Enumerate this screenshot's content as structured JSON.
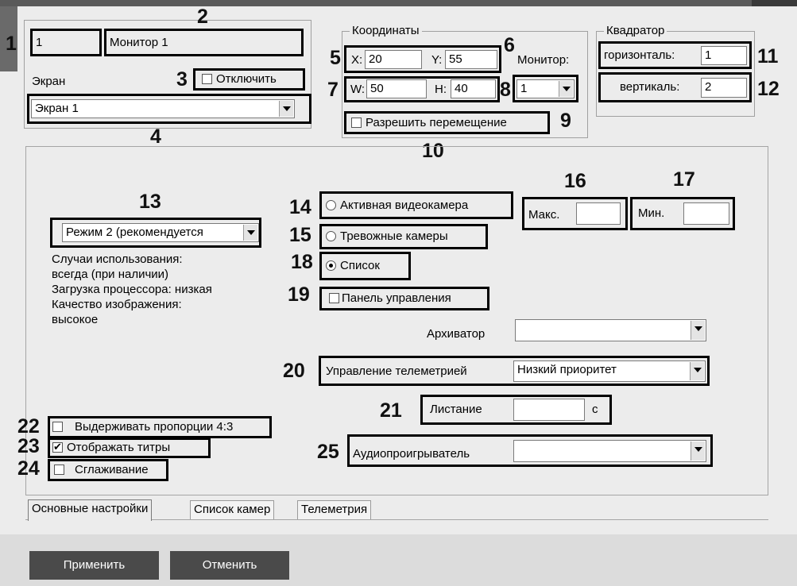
{
  "numbers": [
    "1",
    "2",
    "3",
    "4",
    "5",
    "6",
    "7",
    "8",
    "9",
    "10",
    "11",
    "12",
    "13",
    "14",
    "15",
    "16",
    "17",
    "18",
    "19",
    "20",
    "21",
    "22",
    "23",
    "24",
    "25"
  ],
  "monitor": {
    "id": "1",
    "name": "Монитор 1"
  },
  "screen": {
    "label": "Экран",
    "disable_label": "Отключить",
    "value": "Экран 1"
  },
  "coordinates": {
    "legend": "Координаты",
    "x_label": "X:",
    "x": "20",
    "y_label": "Y:",
    "y": "55",
    "w_label": "W:",
    "w": "50",
    "h_label": "H:",
    "h": "40",
    "monitor_label": "Монитор:",
    "monitor_value": "1",
    "allow_move_label": "Разрешить перемещение"
  },
  "quadrator": {
    "legend": "Квадратор",
    "horizontal_label": "горизонталь:",
    "horizontal": "1",
    "vertical_label": "вертикаль:",
    "vertical": "2"
  },
  "mode": {
    "value": "Режим 2 (рекомендуется",
    "description": [
      "Случаи использования:",
      "всегда (при наличии)",
      "Загрузка процессора: низкая",
      "Качество изображения:",
      "высокое"
    ]
  },
  "options": {
    "active_camera": "Активная видеокамера",
    "alarm_cameras": "Тревожные камеры",
    "list": "Список",
    "control_panel": "Панель управления"
  },
  "minmax": {
    "max_label": "Макс.",
    "min_label": "Мин."
  },
  "archiver": {
    "label": "Архиватор",
    "value": ""
  },
  "telemetry": {
    "label": "Управление телеметрией",
    "value": "Низкий приоритет"
  },
  "scroll": {
    "label": "Листание",
    "unit": "с",
    "value": ""
  },
  "audio": {
    "label": "Аудиопроигрыватель",
    "value": ""
  },
  "checks": {
    "aspect": "Выдерживать пропорции 4:3",
    "titles": "Отображать титры",
    "smoothing": "Сглаживание"
  },
  "tabs": [
    "Основные настройки",
    "Список камер",
    "Телеметрия"
  ],
  "buttons": {
    "apply": "Применить",
    "cancel": "Отменить"
  },
  "colors": {
    "background": "#ececec",
    "button": "#4a4a4a",
    "highlight": "#000000"
  }
}
